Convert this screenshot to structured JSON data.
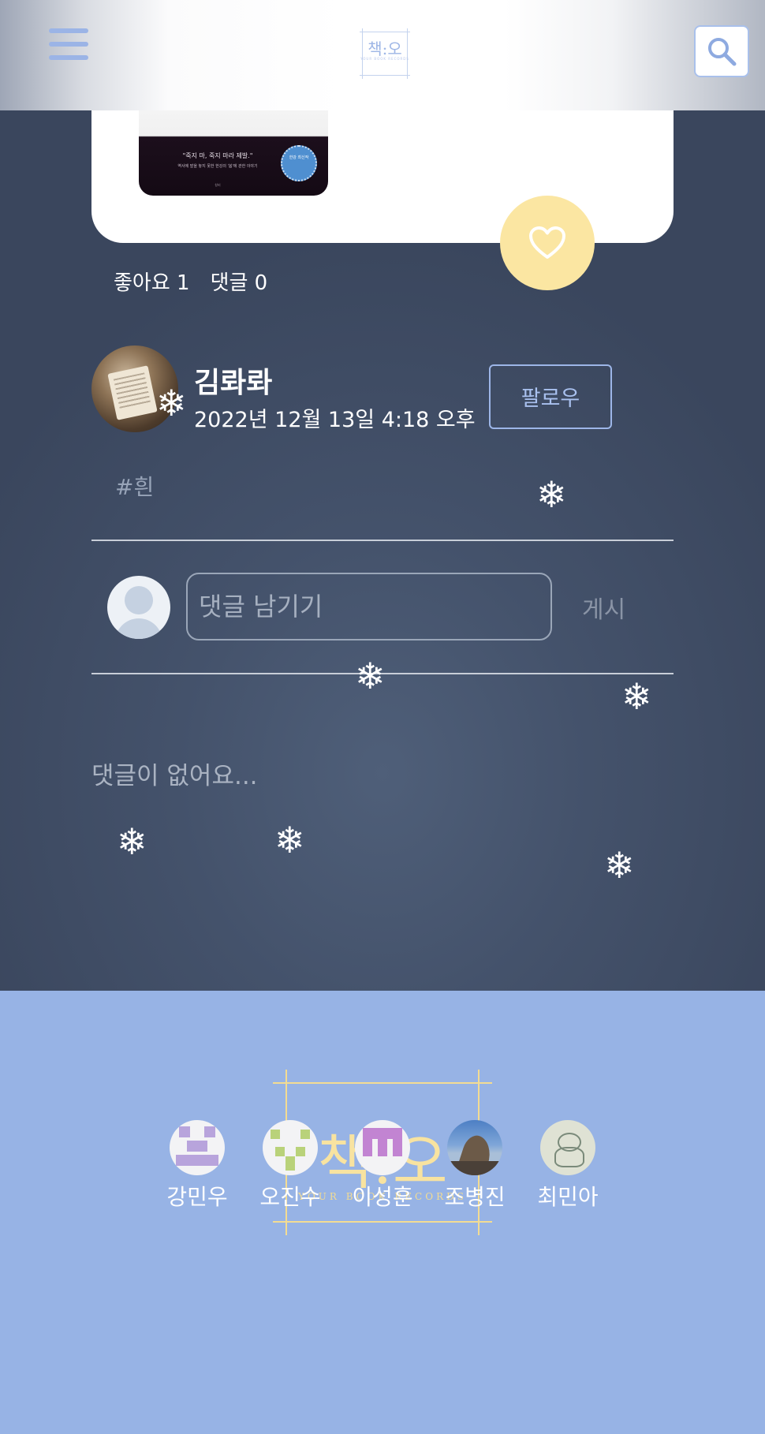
{
  "header": {
    "logo_text": "책:오",
    "logo_subtitle": "YOUR BOOK RECORDS",
    "menu_icon": "hamburger-menu-icon",
    "search_icon": "search-icon"
  },
  "post": {
    "book_cover_quote": "\"죽지 마, 죽지 마라 제발.\"",
    "book_cover_subline": "역사에 발을 놓지 못한 한강의 '봄'에 관한 이야기",
    "book_cover_publisher": "창비",
    "book_cover_badge": "한강 최신작",
    "like_icon": "heart-icon",
    "likes_label": "좋아요 1",
    "comments_label": "댓글 0"
  },
  "author": {
    "name": "김롸롸",
    "date": "2022년 12월 13일 4:18 오후",
    "follow_label": "팔로우",
    "tag": "#흰"
  },
  "comment_form": {
    "placeholder": "댓글 남기기",
    "value": "",
    "submit_label": "게시"
  },
  "comments": {
    "empty_message": "댓글이 없어요..."
  },
  "snowflake": "❄",
  "footer": {
    "logo_text": "책:오",
    "logo_subtitle": "YOUR BOOK RECORDS",
    "members": [
      {
        "name": "강민우"
      },
      {
        "name": "오진수"
      },
      {
        "name": "이성훈"
      },
      {
        "name": "조병진"
      },
      {
        "name": "최민아"
      }
    ]
  },
  "colors": {
    "accent": "#9bb4e6",
    "footer_bg": "#97b3e5",
    "like_button": "#fbe6a2",
    "logo_gold": "#f3dc92",
    "main_bg": "#3d4a63"
  }
}
